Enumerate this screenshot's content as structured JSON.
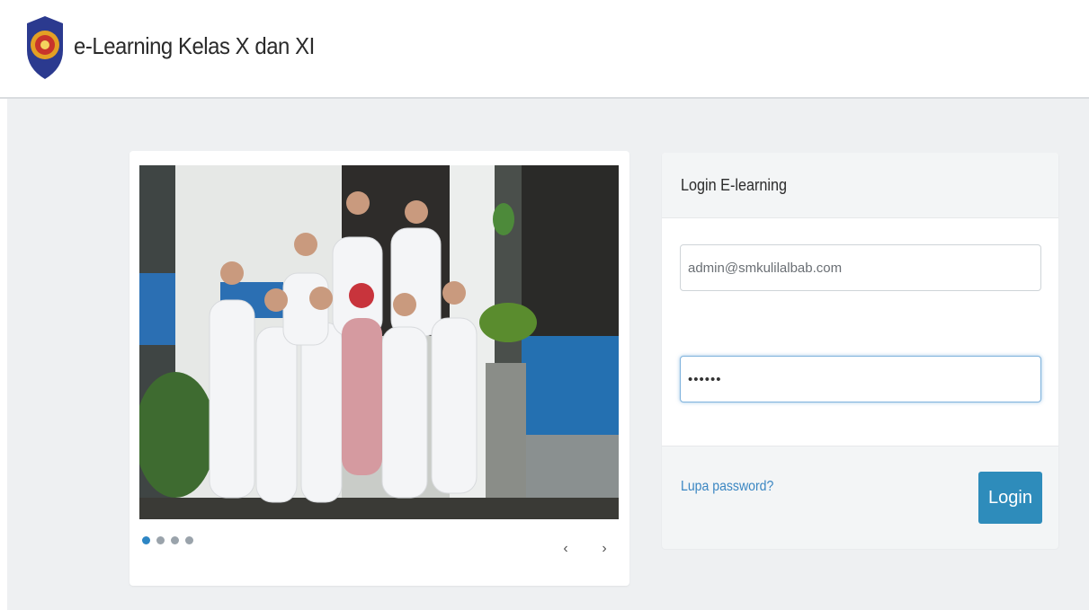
{
  "header": {
    "title": "e-Learning Kelas X dan XI",
    "logo": "school-shield-logo"
  },
  "carousel": {
    "image": "group-photo-students-in-lab-coats",
    "indicators": [
      true,
      false,
      false,
      false
    ],
    "prev_label": "‹",
    "next_label": "›"
  },
  "login": {
    "title": "Login E-learning",
    "email_value": "admin@smkulilalbab.com",
    "password_value": "••••••",
    "forgot_label": "Lupa password?",
    "button_label": "Login"
  },
  "colors": {
    "accent": "#2e8cbb",
    "link": "#3a86c2",
    "background": "#eef0f2"
  }
}
